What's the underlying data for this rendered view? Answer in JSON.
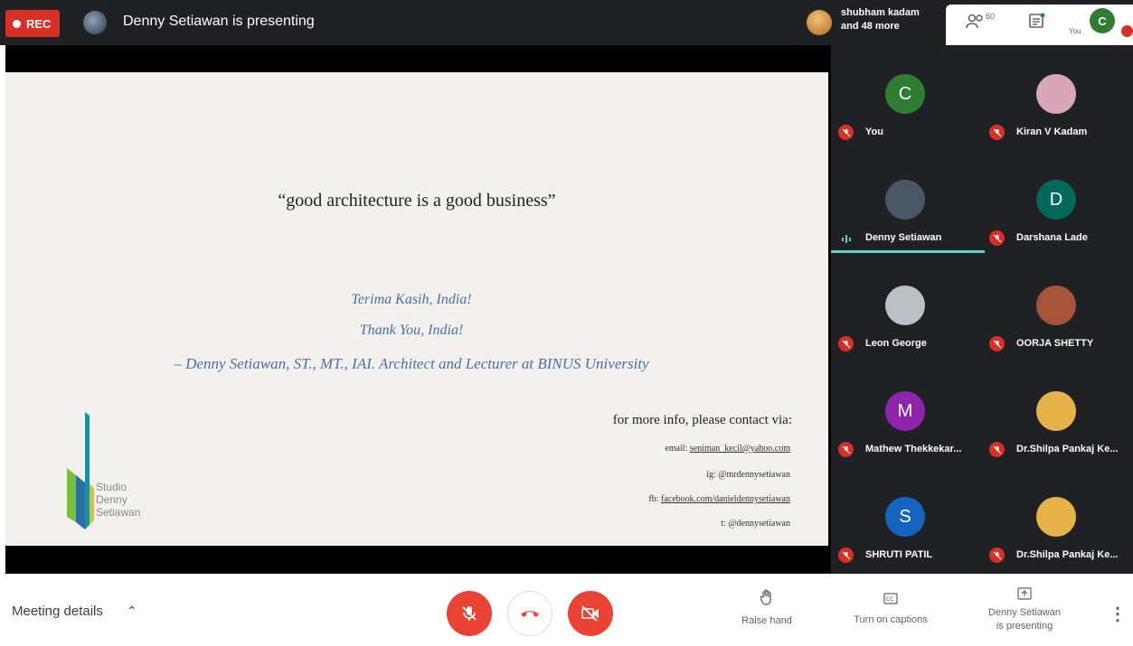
{
  "topbar": {
    "rec_label": "REC",
    "presenting": "Denny Setiawan is presenting",
    "people_line1": "shubham kadam",
    "people_line2": "and 48 more",
    "participant_count": "60",
    "self_label": "You",
    "self_initial": "C",
    "icons": [
      "people-icon",
      "chat-icon"
    ]
  },
  "slide": {
    "quote": "“good architecture is a good business”",
    "thanks1": "Terima Kasih, India!",
    "thanks2": "Thank You, India!",
    "signature": "– Denny Setiawan, ST., MT., IAI. Architect and Lecturer at BINUS University",
    "contact_title": "for more info, please contact via:",
    "email_label": "email: ",
    "email": "seniman_kecil@yahoo.com",
    "ig": "ig: @mrdennysetiawan",
    "fb_label": "fb: ",
    "fb": "facebook.com/danieldennysetiawan",
    "twitter": "t: @dennysetiawan",
    "logo_line1": "Studio",
    "logo_line2": "Denny",
    "logo_line3": "Setiawan",
    "logo_colors": [
      "#1f8f9a",
      "#2b6fa8",
      "#7bbf3e",
      "#d8c32a"
    ]
  },
  "participants": [
    {
      "name": "You",
      "initial": "C",
      "color": "#2e7d32",
      "muted": true
    },
    {
      "name": "Kiran V Kadam",
      "initial": "",
      "color": "#d9a6b8",
      "muted": true
    },
    {
      "name": "Denny Setiawan",
      "initial": "",
      "color": "#4a5663",
      "muted": false,
      "speaking": true
    },
    {
      "name": "Darshana Lade",
      "initial": "D",
      "color": "#00695c",
      "muted": true
    },
    {
      "name": "Leon George",
      "initial": "",
      "color": "#b9c0c6",
      "muted": true
    },
    {
      "name": "OORJA SHETTY",
      "initial": "",
      "color": "#a5543a",
      "muted": true
    },
    {
      "name": "Mathew Thekkekar...",
      "initial": "M",
      "color": "#8e24aa",
      "muted": true
    },
    {
      "name": "Dr.Shilpa Pankaj Ke...",
      "initial": "",
      "color": "#e5b34a",
      "muted": true
    },
    {
      "name": "SHRUTI PATIL",
      "initial": "S",
      "color": "#1565c0",
      "muted": true
    },
    {
      "name": "Dr.Shilpa Pankaj Ke...",
      "initial": "",
      "color": "#e5b34a",
      "muted": true
    }
  ],
  "bottombar": {
    "meeting_details": "Meeting details",
    "raise_hand": "Raise hand",
    "captions": "Turn on captions",
    "presenting_line1": "Denny Setiawan",
    "presenting_line2": "is presenting",
    "accent_red": "#ea4335"
  }
}
